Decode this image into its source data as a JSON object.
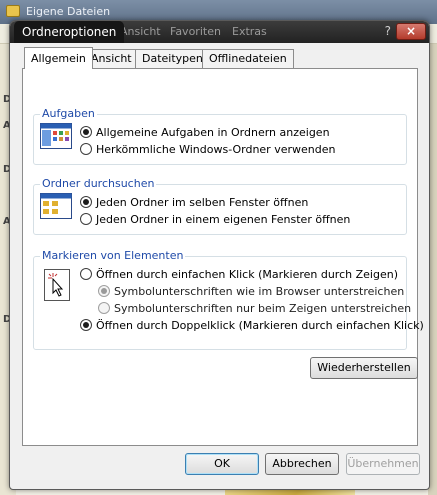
{
  "background_window": {
    "title": "Eigene Dateien",
    "left_letters": [
      "D",
      "A",
      "D",
      "A",
      "D"
    ]
  },
  "dialog": {
    "title": "Ordneroptionen",
    "ghost_menu": [
      "D",
      "Ansicht",
      "Favoriten",
      "Extras"
    ],
    "help_label": "?",
    "close_label": "×",
    "tabs": [
      {
        "label": "Allgemein",
        "active": true
      },
      {
        "label": "Ansicht",
        "active": false
      },
      {
        "label": "Dateitypen",
        "active": false
      },
      {
        "label": "Offlinedateien",
        "active": false
      }
    ],
    "groups": {
      "aufgaben": {
        "legend": "Aufgaben",
        "option1": "Allgemeine Aufgaben in Ordnern anzeigen",
        "option2": "Herkömmliche Windows-Ordner verwenden",
        "selected": 1
      },
      "durchsuchen": {
        "legend": "Ordner durchsuchen",
        "option1": "Jeden Ordner im selben Fenster öffnen",
        "option2": "Jeden Ordner in einem eigenen Fenster öffnen",
        "selected": 1
      },
      "markieren": {
        "legend": "Markieren von Elementen",
        "option1": "Öffnen durch einfachen Klick (Markieren durch Zeigen)",
        "sub1": "Symbolunterschriften wie im Browser unterstreichen",
        "sub2": "Symbolunterschriften nur beim Zeigen unterstreichen",
        "option2": "Öffnen durch Doppelklick (Markieren durch einfachen Klick)",
        "selected": 2
      }
    },
    "restore_button": "Wiederherstellen",
    "ok_button": "OK",
    "cancel_button": "Abbrechen",
    "apply_button": "Übernehmen"
  },
  "colors": {
    "legend_blue": "#1f4aa8",
    "titlebar_dark": "#222222",
    "close_red": "#b33b2c"
  }
}
